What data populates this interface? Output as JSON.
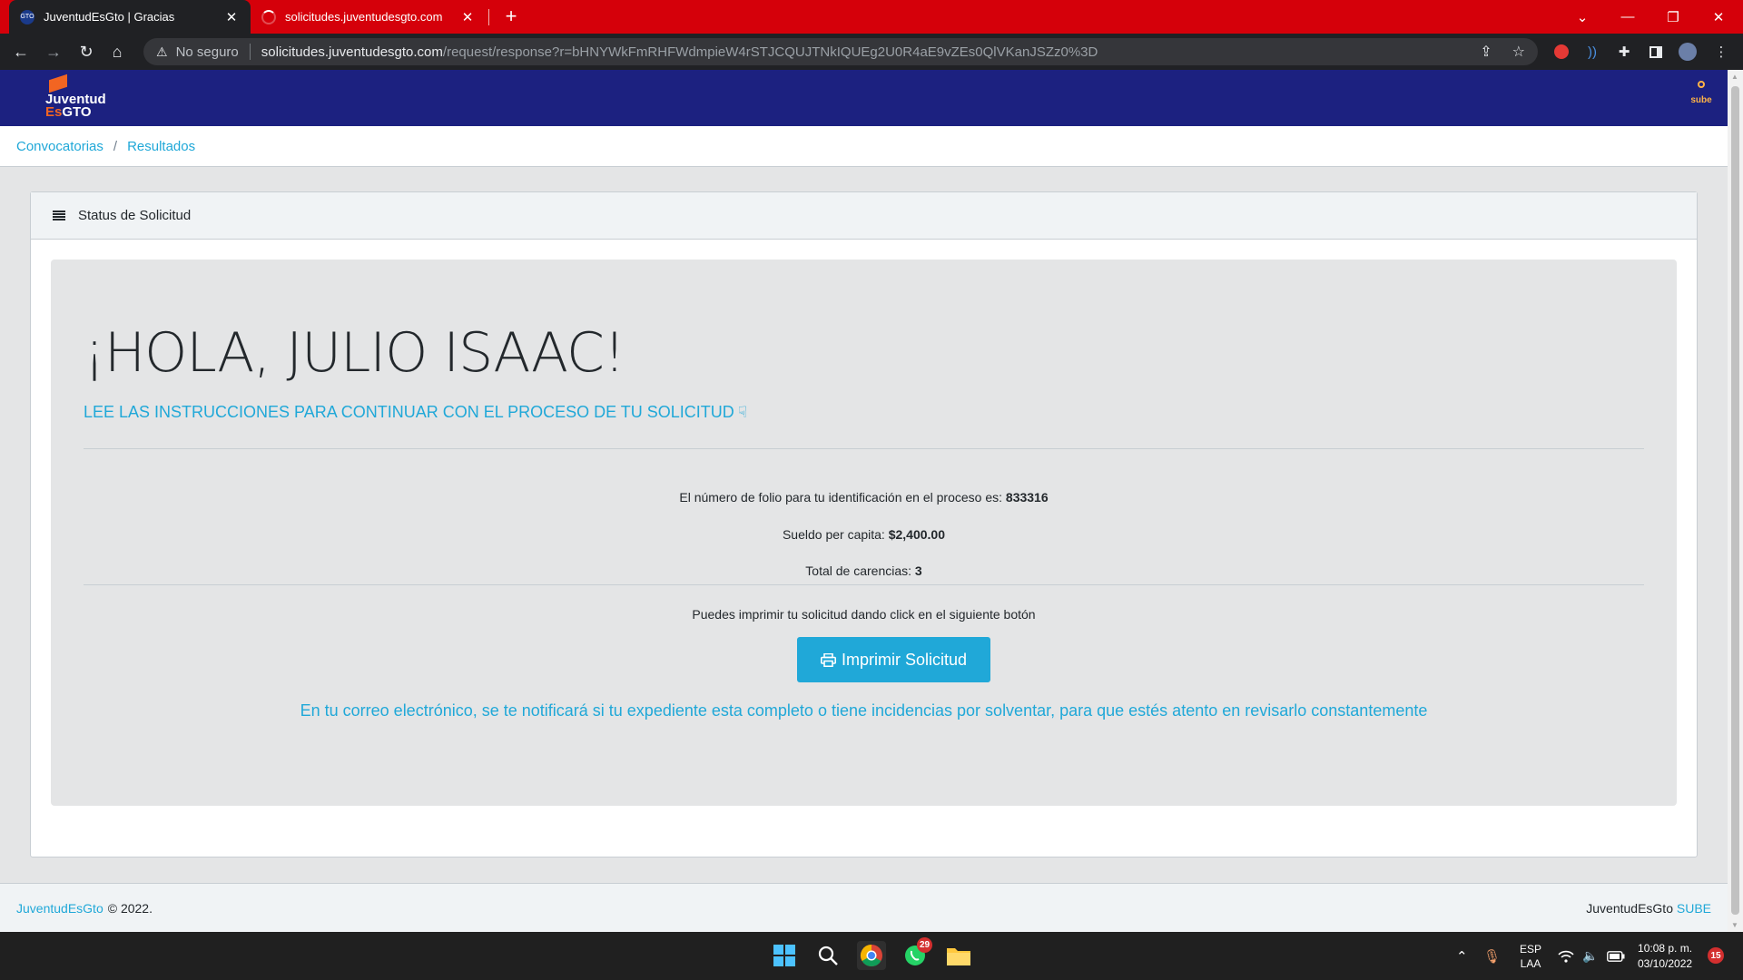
{
  "browser": {
    "tabs": [
      {
        "title": "JuventudEsGto | Gracias",
        "favicon": "GTO"
      },
      {
        "title": "solicitudes.juventudesgto.com"
      }
    ],
    "new_tab": "+",
    "security_label": "No seguro",
    "url_host": "solicitudes.juventudesgto.com",
    "url_path": "/request/response?r=bHNYWkFmRHFWdmpieW4rSTJCQUJTNkIQUEg2U0R4aE9vZEs0QlVKanJSZz0%3D"
  },
  "site": {
    "logo_line1": "Juventud",
    "logo_es": "Es",
    "logo_gto": "GTO",
    "sube_label": "sube"
  },
  "breadcrumb": {
    "items": [
      "Convocatorias",
      "Resultados"
    ],
    "separator": "/"
  },
  "card": {
    "header": "Status de Solicitud",
    "greeting": "¡HOLA, JULIO ISAAC!",
    "lead": "LEE LAS INSTRUCCIONES PARA CONTINUAR CON EL PROCESO DE TU SOLICITUD",
    "folio_label": "El número de folio para tu identificación en el proceso es:",
    "folio_value": "833316",
    "sueldo_label": "Sueldo per capita:",
    "sueldo_value": "$2,400.00",
    "carencias_label": "Total de carencias:",
    "carencias_value": "3",
    "print_hint": "Puedes imprimir tu solicitud dando click en el siguiente botón",
    "print_button": "Imprimir Solicitud",
    "notice": "En tu correo electrónico, se te notificará si tu expediente esta completo o tiene incidencias por solventar, para que estés atento en revisarlo constantemente"
  },
  "footer": {
    "brand_link": "JuventudEsGto",
    "copyright": "© 2022.",
    "right_text": "JuventudEsGto",
    "right_link": "SUBE"
  },
  "taskbar": {
    "whatsapp_badge": "29",
    "lang_line1": "ESP",
    "lang_line2": "LAA",
    "time": "10:08 p. m.",
    "date": "03/10/2022",
    "notification_count": "15"
  },
  "colors": {
    "tabstrip": "#d5000a",
    "site_header": "#1c2180",
    "accent": "#20a8d8",
    "logo_orange": "#f26522"
  }
}
